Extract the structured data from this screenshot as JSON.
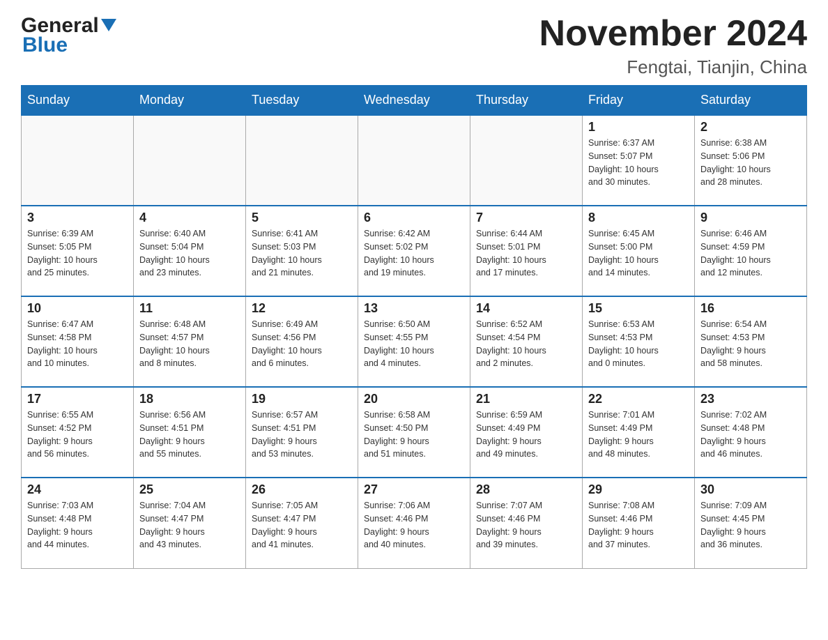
{
  "header": {
    "logo_general": "General",
    "logo_blue": "Blue",
    "month_title": "November 2024",
    "location": "Fengtai, Tianjin, China"
  },
  "weekdays": [
    "Sunday",
    "Monday",
    "Tuesday",
    "Wednesday",
    "Thursday",
    "Friday",
    "Saturday"
  ],
  "weeks": [
    [
      {
        "day": "",
        "info": ""
      },
      {
        "day": "",
        "info": ""
      },
      {
        "day": "",
        "info": ""
      },
      {
        "day": "",
        "info": ""
      },
      {
        "day": "",
        "info": ""
      },
      {
        "day": "1",
        "info": "Sunrise: 6:37 AM\nSunset: 5:07 PM\nDaylight: 10 hours\nand 30 minutes."
      },
      {
        "day": "2",
        "info": "Sunrise: 6:38 AM\nSunset: 5:06 PM\nDaylight: 10 hours\nand 28 minutes."
      }
    ],
    [
      {
        "day": "3",
        "info": "Sunrise: 6:39 AM\nSunset: 5:05 PM\nDaylight: 10 hours\nand 25 minutes."
      },
      {
        "day": "4",
        "info": "Sunrise: 6:40 AM\nSunset: 5:04 PM\nDaylight: 10 hours\nand 23 minutes."
      },
      {
        "day": "5",
        "info": "Sunrise: 6:41 AM\nSunset: 5:03 PM\nDaylight: 10 hours\nand 21 minutes."
      },
      {
        "day": "6",
        "info": "Sunrise: 6:42 AM\nSunset: 5:02 PM\nDaylight: 10 hours\nand 19 minutes."
      },
      {
        "day": "7",
        "info": "Sunrise: 6:44 AM\nSunset: 5:01 PM\nDaylight: 10 hours\nand 17 minutes."
      },
      {
        "day": "8",
        "info": "Sunrise: 6:45 AM\nSunset: 5:00 PM\nDaylight: 10 hours\nand 14 minutes."
      },
      {
        "day": "9",
        "info": "Sunrise: 6:46 AM\nSunset: 4:59 PM\nDaylight: 10 hours\nand 12 minutes."
      }
    ],
    [
      {
        "day": "10",
        "info": "Sunrise: 6:47 AM\nSunset: 4:58 PM\nDaylight: 10 hours\nand 10 minutes."
      },
      {
        "day": "11",
        "info": "Sunrise: 6:48 AM\nSunset: 4:57 PM\nDaylight: 10 hours\nand 8 minutes."
      },
      {
        "day": "12",
        "info": "Sunrise: 6:49 AM\nSunset: 4:56 PM\nDaylight: 10 hours\nand 6 minutes."
      },
      {
        "day": "13",
        "info": "Sunrise: 6:50 AM\nSunset: 4:55 PM\nDaylight: 10 hours\nand 4 minutes."
      },
      {
        "day": "14",
        "info": "Sunrise: 6:52 AM\nSunset: 4:54 PM\nDaylight: 10 hours\nand 2 minutes."
      },
      {
        "day": "15",
        "info": "Sunrise: 6:53 AM\nSunset: 4:53 PM\nDaylight: 10 hours\nand 0 minutes."
      },
      {
        "day": "16",
        "info": "Sunrise: 6:54 AM\nSunset: 4:53 PM\nDaylight: 9 hours\nand 58 minutes."
      }
    ],
    [
      {
        "day": "17",
        "info": "Sunrise: 6:55 AM\nSunset: 4:52 PM\nDaylight: 9 hours\nand 56 minutes."
      },
      {
        "day": "18",
        "info": "Sunrise: 6:56 AM\nSunset: 4:51 PM\nDaylight: 9 hours\nand 55 minutes."
      },
      {
        "day": "19",
        "info": "Sunrise: 6:57 AM\nSunset: 4:51 PM\nDaylight: 9 hours\nand 53 minutes."
      },
      {
        "day": "20",
        "info": "Sunrise: 6:58 AM\nSunset: 4:50 PM\nDaylight: 9 hours\nand 51 minutes."
      },
      {
        "day": "21",
        "info": "Sunrise: 6:59 AM\nSunset: 4:49 PM\nDaylight: 9 hours\nand 49 minutes."
      },
      {
        "day": "22",
        "info": "Sunrise: 7:01 AM\nSunset: 4:49 PM\nDaylight: 9 hours\nand 48 minutes."
      },
      {
        "day": "23",
        "info": "Sunrise: 7:02 AM\nSunset: 4:48 PM\nDaylight: 9 hours\nand 46 minutes."
      }
    ],
    [
      {
        "day": "24",
        "info": "Sunrise: 7:03 AM\nSunset: 4:48 PM\nDaylight: 9 hours\nand 44 minutes."
      },
      {
        "day": "25",
        "info": "Sunrise: 7:04 AM\nSunset: 4:47 PM\nDaylight: 9 hours\nand 43 minutes."
      },
      {
        "day": "26",
        "info": "Sunrise: 7:05 AM\nSunset: 4:47 PM\nDaylight: 9 hours\nand 41 minutes."
      },
      {
        "day": "27",
        "info": "Sunrise: 7:06 AM\nSunset: 4:46 PM\nDaylight: 9 hours\nand 40 minutes."
      },
      {
        "day": "28",
        "info": "Sunrise: 7:07 AM\nSunset: 4:46 PM\nDaylight: 9 hours\nand 39 minutes."
      },
      {
        "day": "29",
        "info": "Sunrise: 7:08 AM\nSunset: 4:46 PM\nDaylight: 9 hours\nand 37 minutes."
      },
      {
        "day": "30",
        "info": "Sunrise: 7:09 AM\nSunset: 4:45 PM\nDaylight: 9 hours\nand 36 minutes."
      }
    ]
  ]
}
